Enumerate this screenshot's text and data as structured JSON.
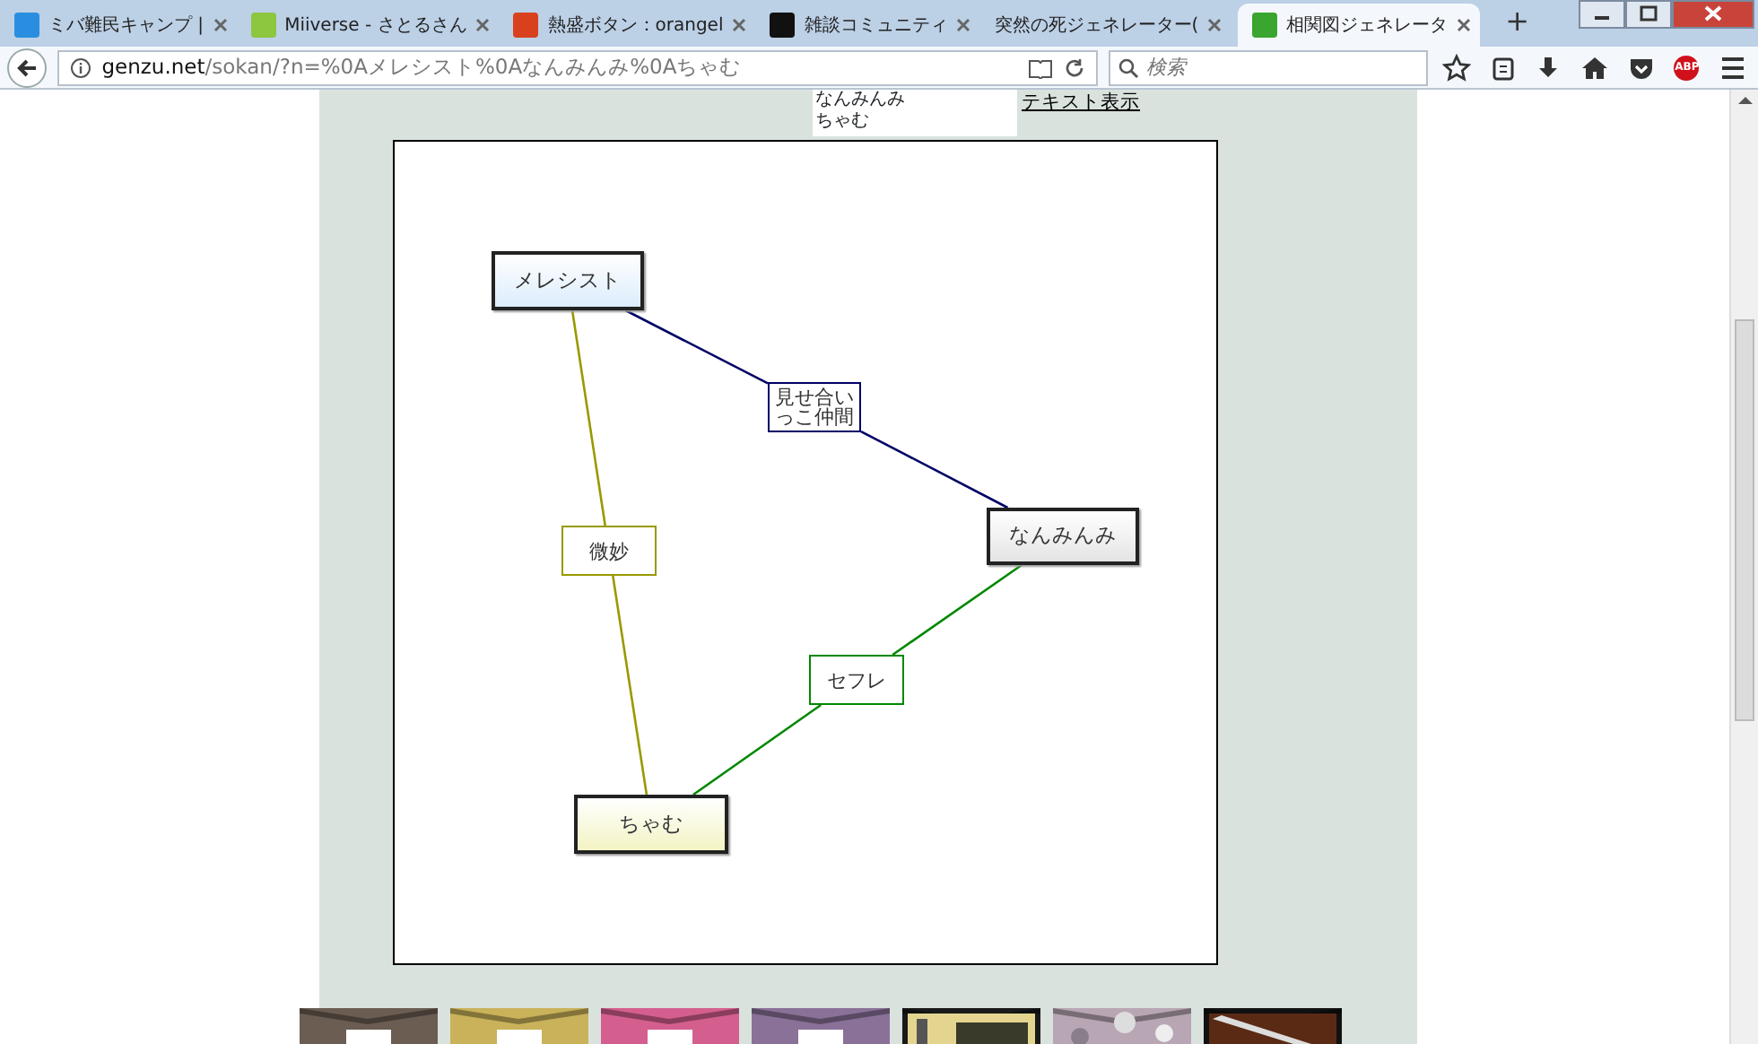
{
  "browser": {
    "tabs": [
      {
        "title": "ミバ難民キャンプ |",
        "selected": false
      },
      {
        "title": "Miiverse - さとるさん",
        "selected": false
      },
      {
        "title": "熱盛ボタン：orangel",
        "selected": false
      },
      {
        "title": "雑談コミュニティ",
        "selected": false
      },
      {
        "title": "突然の死ジェネレーター(",
        "selected": false
      },
      {
        "title": "相関図ジェネレータ",
        "selected": true
      }
    ],
    "new_tab": "+",
    "url_host": "genzu.net",
    "url_path": "/sokan/?n=%0Aメレシスト%0Aなんみんみ%0Aちゃむ",
    "search": {
      "placeholder": "検索"
    },
    "adblock": "ABP"
  },
  "page": {
    "names_field": {
      "lines": [
        "なんみんみ",
        "ちゃむ"
      ]
    },
    "text_link": "テキスト表示",
    "diagram": {
      "nodes": [
        {
          "label": "メレシスト",
          "color": "#dcecfb"
        },
        {
          "label": "なんみんみ",
          "color": "#e4e4e4"
        },
        {
          "label": "ちゃむ",
          "color": "#f3f3c4"
        }
      ],
      "relations": [
        {
          "label": "見せ合いっこ仲間",
          "color": "#000066"
        },
        {
          "label": "微妙",
          "color": "#999900"
        },
        {
          "label": "セフレ",
          "color": "#008800"
        }
      ]
    }
  }
}
